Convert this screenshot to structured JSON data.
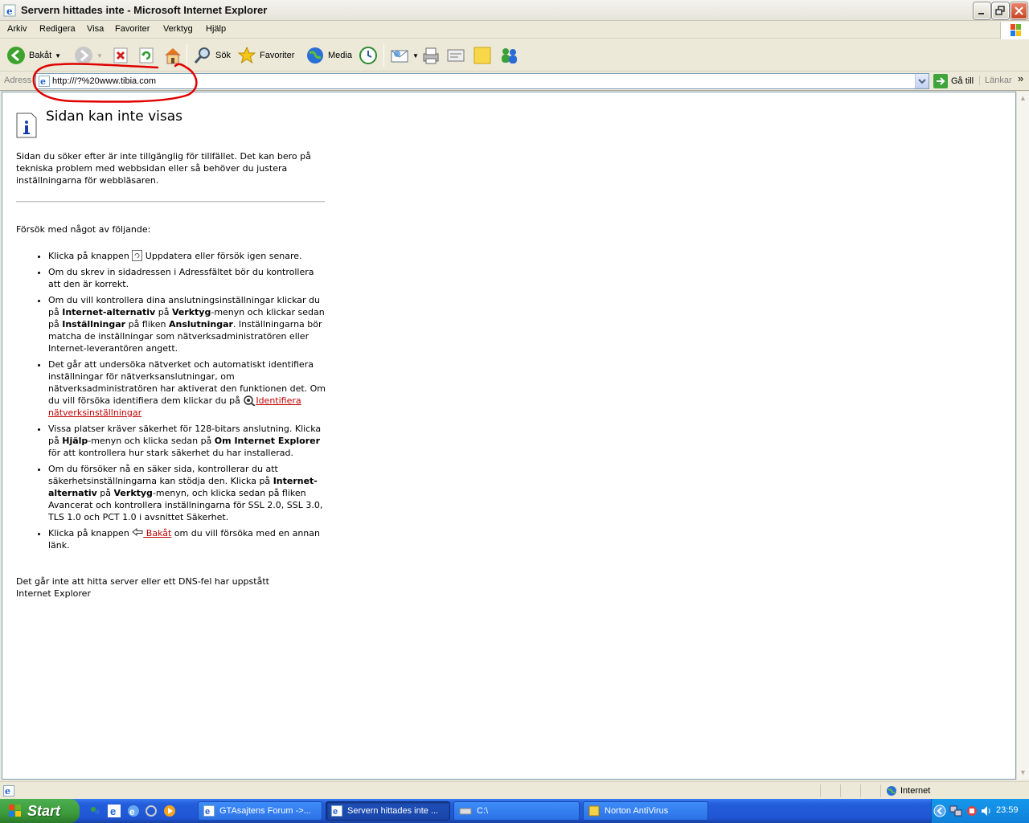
{
  "window": {
    "title": "Servern hittades inte - Microsoft Internet Explorer"
  },
  "menu": [
    "Arkiv",
    "Redigera",
    "Visa",
    "Favoriter",
    "Verktyg",
    "Hjälp"
  ],
  "toolbar": {
    "back": "Bakåt",
    "search": "Sök",
    "favorites": "Favoriter",
    "media": "Media"
  },
  "address": {
    "label": "Adress",
    "url": "http:///?%20www.tibia.com",
    "go": "Gå till",
    "links": "Länkar"
  },
  "page": {
    "heading": "Sidan kan inte visas",
    "intro": "Sidan du söker efter är inte tillgänglig för tillfället. Det kan bero på tekniska problem med webbsidan eller så behöver du justera inställningarna för webbläsaren.",
    "try_label": "Försök med något av följande:",
    "tip1_a": "Klicka på knappen ",
    "tip1_b": " Uppdatera eller försök igen senare.",
    "tip2": "Om du skrev in sidadressen i Adressfältet bör du kontrollera att den är korrekt.",
    "tip3_a": "Om du vill kontrollera dina anslutningsinställningar klickar du på ",
    "tip3_b": "Internet-alternativ",
    "tip3_c": " på ",
    "tip3_d": "Verktyg",
    "tip3_e": "-menyn och klickar sedan på ",
    "tip3_f": "Inställningar",
    "tip3_g": " på fliken ",
    "tip3_h": "Anslutningar",
    "tip3_i": ". Inställningarna bör matcha de inställningar som nätverksadministratören eller Internet-leverantören angett.",
    "tip4_a": "Det går att undersöka nätverket och automatiskt identifiera inställningar för nätverksanslutningar, om nätverksadministratören har aktiverat den funktionen det. Om du vill försöka identifiera dem klickar du på ",
    "tip4_link": "Identifiera nätverksinställningar",
    "tip5_a": "Vissa platser kräver säkerhet för 128-bitars anslutning. Klicka på ",
    "tip5_b": "Hjälp",
    "tip5_c": "-menyn och klicka sedan på ",
    "tip5_d": "Om Internet Explorer",
    "tip5_e": " för att kontrollera hur stark säkerhet du har installerad.",
    "tip6_a": "Om du försöker nå en säker sida, kontrollerar du att säkerhetsinställningarna kan stödja den. Klicka på ",
    "tip6_b": "Internet-alternativ",
    "tip6_c": " på ",
    "tip6_d": "Verktyg",
    "tip6_e": "-menyn, och klicka sedan på fliken Avancerat och kontrollera inställningarna för SSL 2.0, SSL 3.0, TLS 1.0 och PCT 1.0 i avsnittet Säkerhet.",
    "tip7_a": "Klicka på knappen ",
    "tip7_link": " Bakåt",
    "tip7_b": " om du vill försöka med en annan länk.",
    "footer1": "Det går inte att hitta server eller ett DNS-fel har uppstått",
    "footer2": "Internet Explorer"
  },
  "status": {
    "zone": "Internet"
  },
  "taskbar": {
    "start": "Start",
    "tasks": [
      "GTAsajtens Forum ->...",
      "Servern hittades inte ...",
      "C:\\",
      "Norton AntiVirus"
    ],
    "clock": "23:59"
  },
  "colors": {
    "annotation": "#e00000",
    "link": "#c00000",
    "taskbar": "#245edb"
  }
}
